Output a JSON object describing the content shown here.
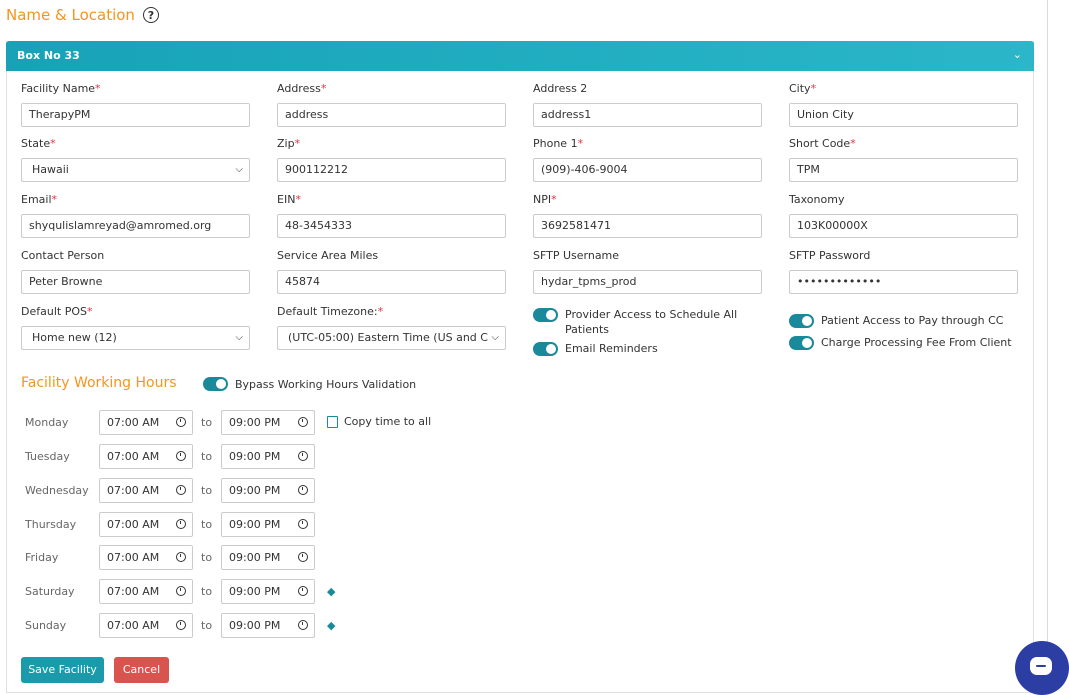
{
  "page": {
    "section_title": "Name & Location",
    "help_icon": "?"
  },
  "panel": {
    "title": "Box No 33",
    "chevron": "⌄"
  },
  "fields": {
    "facility_name": {
      "label": "Facility Name",
      "value": "TherapyPM"
    },
    "address": {
      "label": "Address",
      "value": "address"
    },
    "address2": {
      "label": "Address 2",
      "value": "address1"
    },
    "city": {
      "label": "City",
      "value": "Union City"
    },
    "state": {
      "label": "State",
      "value": "Hawaii"
    },
    "zip": {
      "label": "Zip",
      "value": "900112212"
    },
    "phone1": {
      "label": "Phone 1",
      "value": "(909)-406-9004"
    },
    "short_code": {
      "label": "Short Code",
      "value": "TPM"
    },
    "email": {
      "label": "Email",
      "value": "shyqulislamreyad@amromed.org"
    },
    "ein": {
      "label": "EIN",
      "value": "48-3454333"
    },
    "npi": {
      "label": "NPI",
      "value": "3692581471"
    },
    "taxonomy": {
      "label": "Taxonomy",
      "value": "103K00000X"
    },
    "contact_person": {
      "label": "Contact Person",
      "value": "Peter Browne"
    },
    "service_area_miles": {
      "label": "Service Area Miles",
      "value": "45874"
    },
    "sftp_username": {
      "label": "SFTP Username",
      "value": "hydar_tpms_prod"
    },
    "sftp_password": {
      "label": "SFTP Password",
      "value": "•••••••••••••"
    },
    "default_pos": {
      "label": "Default POS",
      "value": "Home new (12)"
    },
    "default_timezone": {
      "label": "Default Timezone:",
      "value": "(UTC-05:00) Eastern Time (US and C"
    }
  },
  "required_mark": "*",
  "toggles": {
    "provider_access": {
      "label_line1": "Provider Access to Schedule All",
      "label_line2": "Patients",
      "on": true
    },
    "email_reminders": {
      "label": "Email Reminders",
      "on": true
    },
    "patient_access": {
      "label": "Patient Access to Pay through CC",
      "on": true
    },
    "charge_fee": {
      "label": "Charge Processing Fee From Client",
      "on": true
    }
  },
  "hours": {
    "title": "Facility Working Hours",
    "bypass_label": "Bypass Working Hours Validation",
    "to_label": "to",
    "copy_label": "Copy time to all",
    "days": [
      {
        "name": "Monday",
        "start": "07:00 AM",
        "end": "09:00 PM"
      },
      {
        "name": "Tuesday",
        "start": "07:00 AM",
        "end": "09:00 PM"
      },
      {
        "name": "Wednesday",
        "start": "07:00 AM",
        "end": "09:00 PM"
      },
      {
        "name": "Thursday",
        "start": "07:00 AM",
        "end": "09:00 PM"
      },
      {
        "name": "Friday",
        "start": "07:00 AM",
        "end": "09:00 PM"
      },
      {
        "name": "Saturday",
        "start": "07:00 AM",
        "end": "09:00 PM"
      },
      {
        "name": "Sunday",
        "start": "07:00 AM",
        "end": "09:00 PM"
      }
    ]
  },
  "buttons": {
    "save": "Save Facility",
    "cancel": "Cancel"
  },
  "colors": {
    "accent": "#17a2b8",
    "orange": "#f7941d",
    "toggle": "#1a8a9a",
    "cancel": "#d9534f",
    "chat": "#2c3ea3"
  }
}
